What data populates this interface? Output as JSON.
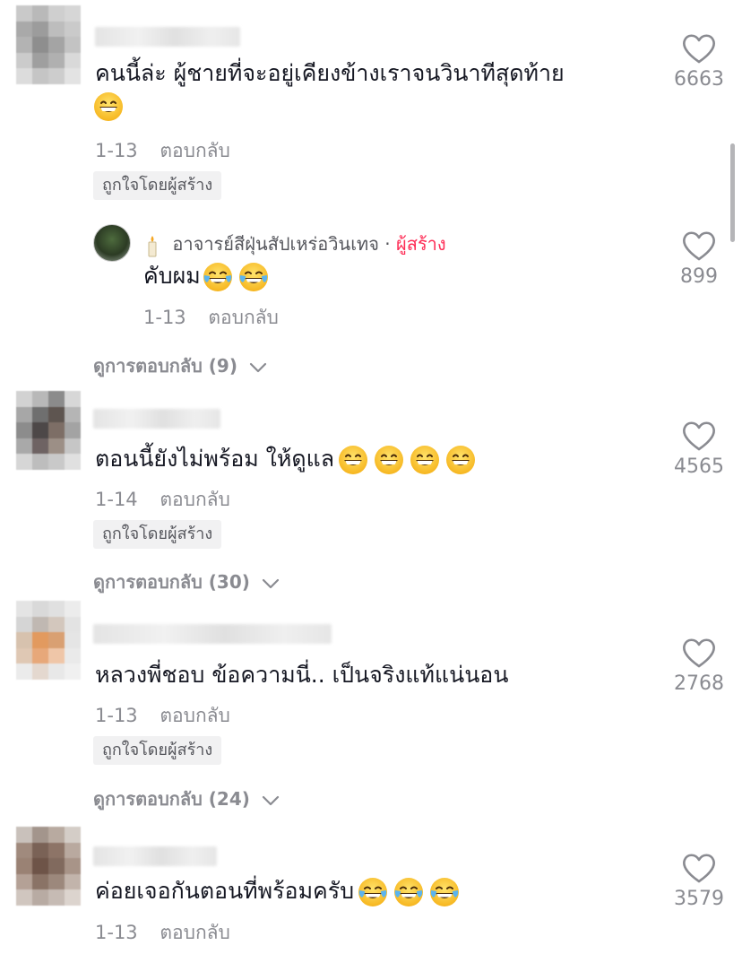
{
  "comments": [
    {
      "text": "คนนี้ล่ะ ผู้ชายที่จะอยู่เคียงข้างเราจนวินาทีสุดท้าย",
      "emojis": [
        "grin"
      ],
      "date": "1-13",
      "reply_label": "ตอบกลับ",
      "liked_by_creator": "ถูกใจโดยผู้สร้าง",
      "likes": "6663",
      "reply": {
        "author": "อาจารย์สีฝุ่นสัปเหร่อวินเทจ",
        "separator": "·",
        "creator_badge": "ผู้สร้าง",
        "text": "คับผม",
        "emojis": [
          "joy",
          "joy"
        ],
        "date": "1-13",
        "reply_label": "ตอบกลับ",
        "likes": "899"
      },
      "view_replies": "ดูการตอบกลับ (9)"
    },
    {
      "text": "ตอนนี้ยังไม่พร้อม ให้ดูแล",
      "emojis": [
        "grin",
        "grin",
        "grin",
        "grin"
      ],
      "date": "1-14",
      "reply_label": "ตอบกลับ",
      "liked_by_creator": "ถูกใจโดยผู้สร้าง",
      "likes": "4565",
      "view_replies": "ดูการตอบกลับ (30)"
    },
    {
      "text": "หลวงพี่ชอบ ข้อความนี่.. เป็นจริงแท้แน่นอน",
      "emojis": [],
      "date": "1-13",
      "reply_label": "ตอบกลับ",
      "liked_by_creator": "ถูกใจโดยผู้สร้าง",
      "likes": "2768",
      "view_replies": "ดูการตอบกลับ (24)"
    },
    {
      "text": "ค่อยเจอกันตอนที่พร้อมครับ",
      "emojis": [
        "joy",
        "joy",
        "joy"
      ],
      "date": "1-13",
      "reply_label": "ตอบกลับ",
      "likes": "3579"
    }
  ],
  "colors": {
    "creator_badge": "#fe2c55",
    "meta_text": "#8a8b91",
    "main_text": "#161823"
  }
}
